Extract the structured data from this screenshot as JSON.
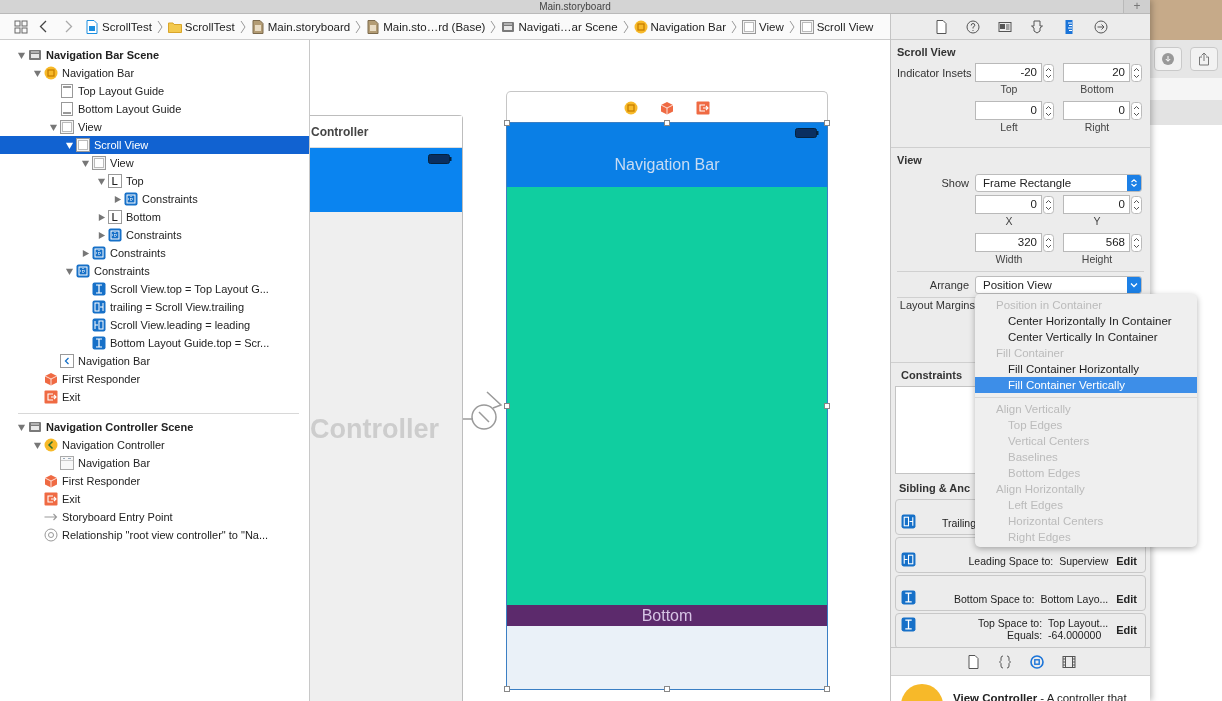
{
  "window": {
    "title": "Main.storyboard",
    "add_tab": "+"
  },
  "jump_bar": {
    "path": [
      {
        "label": "ScrollTest",
        "kind": "project"
      },
      {
        "label": "ScrollTest",
        "kind": "folder"
      },
      {
        "label": "Main.storyboard",
        "kind": "storyboard"
      },
      {
        "label": "Main.sto…rd (Base)",
        "kind": "storyboard"
      },
      {
        "label": "Navigati…ar Scene",
        "kind": "scene"
      },
      {
        "label": "Navigation Bar",
        "kind": "controller"
      },
      {
        "label": "View",
        "kind": "view"
      },
      {
        "label": "Scroll View",
        "kind": "view"
      }
    ]
  },
  "outline": {
    "scenes": [
      {
        "label": "Navigation Bar Scene",
        "kind": "scene",
        "expanded": true,
        "selected": false,
        "children": [
          {
            "label": "Navigation Bar",
            "kind": "controller",
            "expanded": true,
            "selected": false,
            "children": [
              {
                "label": "Top Layout Guide",
                "kind": "guide-top",
                "selected": false
              },
              {
                "label": "Bottom Layout Guide",
                "kind": "guide-bottom",
                "selected": false
              },
              {
                "label": "View",
                "kind": "view",
                "expanded": true,
                "selected": false,
                "children": [
                  {
                    "label": "Scroll View",
                    "kind": "view",
                    "expanded": true,
                    "selected": true,
                    "children": [
                      {
                        "label": "View",
                        "kind": "view",
                        "expanded": true,
                        "selected": false,
                        "children": [
                          {
                            "label": "Top",
                            "kind": "label",
                            "expanded": true,
                            "selected": false,
                            "children": [
                              {
                                "label": "Constraints",
                                "kind": "constraints",
                                "expanded": false,
                                "selected": false
                              }
                            ]
                          },
                          {
                            "label": "Bottom",
                            "kind": "label",
                            "expanded": false,
                            "selected": false
                          },
                          {
                            "label": "Constraints",
                            "kind": "constraints",
                            "expanded": false,
                            "selected": false
                          }
                        ]
                      },
                      {
                        "label": "Constraints",
                        "kind": "constraints",
                        "expanded": false,
                        "selected": false
                      }
                    ]
                  },
                  {
                    "label": "Constraints",
                    "kind": "constraints",
                    "expanded": true,
                    "selected": false,
                    "children": [
                      {
                        "label": "Scroll View.top = Top Layout G...",
                        "kind": "constraint-v",
                        "selected": false
                      },
                      {
                        "label": "trailing = Scroll View.trailing",
                        "kind": "constraint-trailing",
                        "selected": false
                      },
                      {
                        "label": "Scroll View.leading = leading",
                        "kind": "constraint-leading",
                        "selected": false
                      },
                      {
                        "label": "Bottom Layout Guide.top = Scr...",
                        "kind": "constraint-v",
                        "selected": false
                      }
                    ]
                  }
                ]
              },
              {
                "label": "Navigation Bar",
                "kind": "back",
                "selected": false
              }
            ]
          },
          {
            "label": "First Responder",
            "kind": "responder",
            "selected": false
          },
          {
            "label": "Exit",
            "kind": "exit",
            "selected": false
          }
        ]
      },
      {
        "label": "Navigation Controller Scene",
        "kind": "scene",
        "expanded": true,
        "selected": false,
        "children": [
          {
            "label": "Navigation Controller",
            "kind": "nav-controller",
            "expanded": true,
            "selected": false,
            "children": [
              {
                "label": "Navigation Bar",
                "kind": "navbar",
                "selected": false
              }
            ]
          },
          {
            "label": "First Responder",
            "kind": "responder",
            "selected": false
          },
          {
            "label": "Exit",
            "kind": "exit",
            "selected": false
          },
          {
            "label": "Storyboard Entry Point",
            "kind": "entry",
            "selected": false
          },
          {
            "label": "Relationship \"root view controller\" to \"Na...",
            "kind": "relationship",
            "selected": false
          }
        ]
      }
    ]
  },
  "canvas": {
    "left_scene": {
      "title": "Controller",
      "watermark": "Controller"
    },
    "right_scene": {
      "nav_title": "Navigation Bar",
      "bottom_label": "Bottom"
    }
  },
  "inspector": {
    "tabs": [
      {
        "kind": "file",
        "selected": false
      },
      {
        "kind": "help",
        "selected": false
      },
      {
        "kind": "identity",
        "selected": false
      },
      {
        "kind": "attributes",
        "selected": false
      },
      {
        "kind": "size",
        "selected": true
      },
      {
        "kind": "connections",
        "selected": false
      }
    ],
    "scroll_view": {
      "heading": "Scroll View",
      "insets_label": "Indicator Insets",
      "fields": [
        {
          "value": "-20",
          "caption": "Top"
        },
        {
          "value": "20",
          "caption": "Bottom"
        },
        {
          "value": "0",
          "caption": "Left"
        },
        {
          "value": "0",
          "caption": "Right"
        }
      ]
    },
    "view": {
      "heading": "View",
      "show_label": "Show",
      "show_value": "Frame Rectangle",
      "fields": [
        {
          "value": "0",
          "caption": "X"
        },
        {
          "value": "0",
          "caption": "Y"
        },
        {
          "value": "320",
          "caption": "Width"
        },
        {
          "value": "568",
          "caption": "Height"
        }
      ],
      "arrange_label": "Arrange",
      "arrange_value": "Position View",
      "margins_label": "Layout Margins"
    },
    "constraints": {
      "heading": "Constraints",
      "sibling_heading": "Sibling & Anc",
      "cards": [
        {
          "kind": "constraint-trailing",
          "label": "Trailing"
        },
        {
          "kind": "constraint-leading",
          "label": "Leading Space to:",
          "value": "Superview",
          "action": "Edit"
        },
        {
          "kind": "constraint-v",
          "label": "Bottom Space to:",
          "value": "Bottom Layo...",
          "action": "Edit"
        },
        {
          "kind": "constraint-v",
          "label": "Top Space to:",
          "value": "Top Layout...",
          "label2": "Equals:",
          "value2": "-64.000000",
          "action": "Edit"
        }
      ]
    }
  },
  "menu": {
    "items": [
      {
        "kind": "header",
        "label": "Position in Container"
      },
      {
        "kind": "item",
        "label": "Center Horizontally In Container",
        "disabled": false,
        "selected": false
      },
      {
        "kind": "item",
        "label": "Center Vertically In Container",
        "disabled": false,
        "selected": false
      },
      {
        "kind": "header",
        "label": "Fill Container"
      },
      {
        "kind": "item",
        "label": "Fill Container Horizontally",
        "disabled": false,
        "selected": false
      },
      {
        "kind": "item",
        "label": "Fill Container Vertically",
        "disabled": false,
        "selected": true
      },
      {
        "kind": "separator"
      },
      {
        "kind": "header",
        "label": "Align Vertically"
      },
      {
        "kind": "item",
        "label": "Top Edges",
        "disabled": true,
        "selected": false
      },
      {
        "kind": "item",
        "label": "Vertical Centers",
        "disabled": true,
        "selected": false
      },
      {
        "kind": "item",
        "label": "Baselines",
        "disabled": true,
        "selected": false
      },
      {
        "kind": "item",
        "label": "Bottom Edges",
        "disabled": true,
        "selected": false
      },
      {
        "kind": "header",
        "label": "Align Horizontally"
      },
      {
        "kind": "item",
        "label": "Left Edges",
        "disabled": true,
        "selected": false
      },
      {
        "kind": "item",
        "label": "Horizontal Centers",
        "disabled": true,
        "selected": false
      },
      {
        "kind": "item",
        "label": "Right Edges",
        "disabled": true,
        "selected": false
      }
    ]
  },
  "library": {
    "tabs": [
      {
        "kind": "file",
        "selected": false
      },
      {
        "kind": "braces",
        "selected": false
      },
      {
        "kind": "object",
        "selected": true
      },
      {
        "kind": "media",
        "selected": false
      }
    ],
    "entry": "**View Controller** - A controller that"
  }
}
